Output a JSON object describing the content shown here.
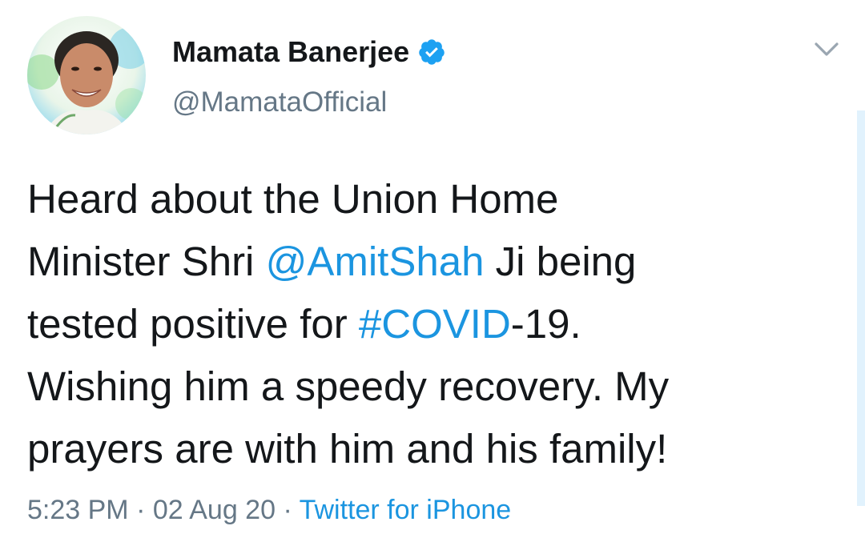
{
  "author": {
    "display_name": "Mamata Banerjee",
    "handle": "@MamataOfficial",
    "verified": true,
    "avatar_icon": "profile-photo"
  },
  "tweet": {
    "line1": "Heard about the Union Home",
    "line2_pre": "Minister Shri ",
    "mention": "@AmitShah",
    "line2_post": " Ji being",
    "line3_pre": "tested positive for ",
    "hashtag": "#COVID",
    "line3_post": "-19.",
    "line4": "Wishing him a speedy recovery. My",
    "line5": "prayers are with him and his family!"
  },
  "meta": {
    "time": "5:23 PM",
    "separator1": " · ",
    "date": "02 Aug 20",
    "separator2": " · ",
    "source": "Twitter for iPhone"
  },
  "colors": {
    "text": "#14171a",
    "secondary": "#657786",
    "link": "#1b95e0",
    "verified": "#1da1f2"
  },
  "icons": {
    "menu": "chevron-down-icon",
    "verified": "verified-badge-icon"
  }
}
